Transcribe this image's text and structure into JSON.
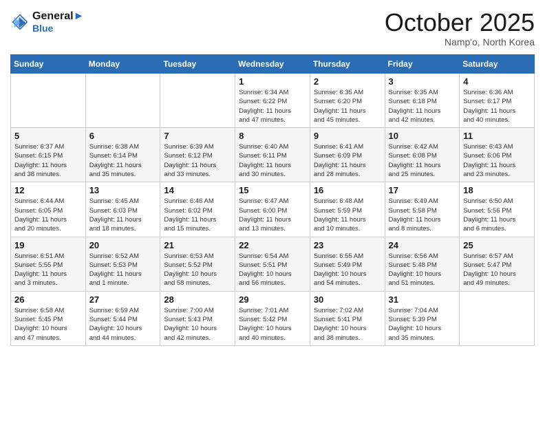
{
  "header": {
    "logo_line1": "General",
    "logo_line2": "Blue",
    "month_title": "October 2025",
    "location": "Namp'o, North Korea"
  },
  "weekdays": [
    "Sunday",
    "Monday",
    "Tuesday",
    "Wednesday",
    "Thursday",
    "Friday",
    "Saturday"
  ],
  "weeks": [
    [
      {
        "day": "",
        "info": ""
      },
      {
        "day": "",
        "info": ""
      },
      {
        "day": "",
        "info": ""
      },
      {
        "day": "1",
        "info": "Sunrise: 6:34 AM\nSunset: 6:22 PM\nDaylight: 11 hours\nand 47 minutes."
      },
      {
        "day": "2",
        "info": "Sunrise: 6:35 AM\nSunset: 6:20 PM\nDaylight: 11 hours\nand 45 minutes."
      },
      {
        "day": "3",
        "info": "Sunrise: 6:35 AM\nSunset: 6:18 PM\nDaylight: 11 hours\nand 42 minutes."
      },
      {
        "day": "4",
        "info": "Sunrise: 6:36 AM\nSunset: 6:17 PM\nDaylight: 11 hours\nand 40 minutes."
      }
    ],
    [
      {
        "day": "5",
        "info": "Sunrise: 6:37 AM\nSunset: 6:15 PM\nDaylight: 11 hours\nand 38 minutes."
      },
      {
        "day": "6",
        "info": "Sunrise: 6:38 AM\nSunset: 6:14 PM\nDaylight: 11 hours\nand 35 minutes."
      },
      {
        "day": "7",
        "info": "Sunrise: 6:39 AM\nSunset: 6:12 PM\nDaylight: 11 hours\nand 33 minutes."
      },
      {
        "day": "8",
        "info": "Sunrise: 6:40 AM\nSunset: 6:11 PM\nDaylight: 11 hours\nand 30 minutes."
      },
      {
        "day": "9",
        "info": "Sunrise: 6:41 AM\nSunset: 6:09 PM\nDaylight: 11 hours\nand 28 minutes."
      },
      {
        "day": "10",
        "info": "Sunrise: 6:42 AM\nSunset: 6:08 PM\nDaylight: 11 hours\nand 25 minutes."
      },
      {
        "day": "11",
        "info": "Sunrise: 6:43 AM\nSunset: 6:06 PM\nDaylight: 11 hours\nand 23 minutes."
      }
    ],
    [
      {
        "day": "12",
        "info": "Sunrise: 6:44 AM\nSunset: 6:05 PM\nDaylight: 11 hours\nand 20 minutes."
      },
      {
        "day": "13",
        "info": "Sunrise: 6:45 AM\nSunset: 6:03 PM\nDaylight: 11 hours\nand 18 minutes."
      },
      {
        "day": "14",
        "info": "Sunrise: 6:46 AM\nSunset: 6:02 PM\nDaylight: 11 hours\nand 15 minutes."
      },
      {
        "day": "15",
        "info": "Sunrise: 6:47 AM\nSunset: 6:00 PM\nDaylight: 11 hours\nand 13 minutes."
      },
      {
        "day": "16",
        "info": "Sunrise: 6:48 AM\nSunset: 5:59 PM\nDaylight: 11 hours\nand 10 minutes."
      },
      {
        "day": "17",
        "info": "Sunrise: 6:49 AM\nSunset: 5:58 PM\nDaylight: 11 hours\nand 8 minutes."
      },
      {
        "day": "18",
        "info": "Sunrise: 6:50 AM\nSunset: 5:56 PM\nDaylight: 11 hours\nand 6 minutes."
      }
    ],
    [
      {
        "day": "19",
        "info": "Sunrise: 6:51 AM\nSunset: 5:55 PM\nDaylight: 11 hours\nand 3 minutes."
      },
      {
        "day": "20",
        "info": "Sunrise: 6:52 AM\nSunset: 5:53 PM\nDaylight: 11 hours\nand 1 minute."
      },
      {
        "day": "21",
        "info": "Sunrise: 6:53 AM\nSunset: 5:52 PM\nDaylight: 10 hours\nand 58 minutes."
      },
      {
        "day": "22",
        "info": "Sunrise: 6:54 AM\nSunset: 5:51 PM\nDaylight: 10 hours\nand 56 minutes."
      },
      {
        "day": "23",
        "info": "Sunrise: 6:55 AM\nSunset: 5:49 PM\nDaylight: 10 hours\nand 54 minutes."
      },
      {
        "day": "24",
        "info": "Sunrise: 6:56 AM\nSunset: 5:48 PM\nDaylight: 10 hours\nand 51 minutes."
      },
      {
        "day": "25",
        "info": "Sunrise: 6:57 AM\nSunset: 5:47 PM\nDaylight: 10 hours\nand 49 minutes."
      }
    ],
    [
      {
        "day": "26",
        "info": "Sunrise: 6:58 AM\nSunset: 5:45 PM\nDaylight: 10 hours\nand 47 minutes."
      },
      {
        "day": "27",
        "info": "Sunrise: 6:59 AM\nSunset: 5:44 PM\nDaylight: 10 hours\nand 44 minutes."
      },
      {
        "day": "28",
        "info": "Sunrise: 7:00 AM\nSunset: 5:43 PM\nDaylight: 10 hours\nand 42 minutes."
      },
      {
        "day": "29",
        "info": "Sunrise: 7:01 AM\nSunset: 5:42 PM\nDaylight: 10 hours\nand 40 minutes."
      },
      {
        "day": "30",
        "info": "Sunrise: 7:02 AM\nSunset: 5:41 PM\nDaylight: 10 hours\nand 38 minutes."
      },
      {
        "day": "31",
        "info": "Sunrise: 7:04 AM\nSunset: 5:39 PM\nDaylight: 10 hours\nand 35 minutes."
      },
      {
        "day": "",
        "info": ""
      }
    ]
  ]
}
